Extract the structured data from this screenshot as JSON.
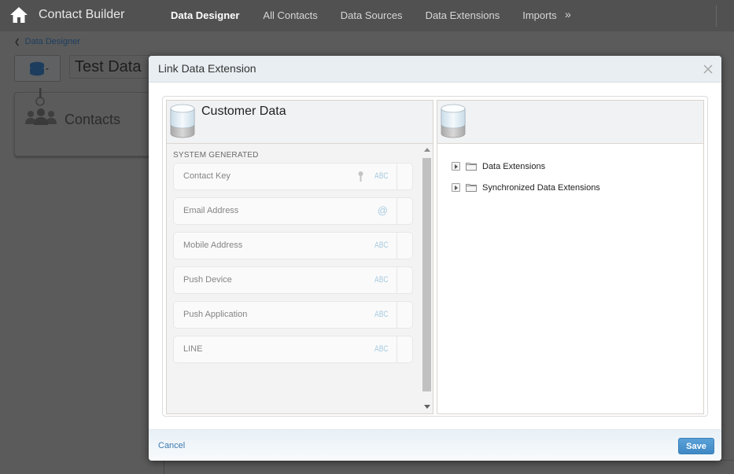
{
  "app": {
    "title": "Contact Builder",
    "home_icon": "home-icon"
  },
  "nav": {
    "items": [
      {
        "label": "Data Designer",
        "active": true
      },
      {
        "label": "All Contacts",
        "active": false
      },
      {
        "label": "Data Sources",
        "active": false
      },
      {
        "label": "Data Extensions",
        "active": false
      },
      {
        "label": "Imports",
        "active": false
      }
    ],
    "more_label": "»"
  },
  "page": {
    "breadcrumb": "Data Designer",
    "name_field_value": "Test Data",
    "db_menu_icon": "database-icon",
    "card_label": "Contacts"
  },
  "modal": {
    "title": "Link Data Extension",
    "close_icon": "close-icon",
    "left_panel": {
      "title": "Customer Data",
      "section_label": "SYSTEM GENERATED",
      "fields": [
        {
          "name": "Contact Key",
          "type": "ABC",
          "is_key": true
        },
        {
          "name": "Email Address",
          "type": "@",
          "is_key": false
        },
        {
          "name": "Mobile Address",
          "type": "ABC",
          "is_key": false
        },
        {
          "name": "Push Device",
          "type": "ABC",
          "is_key": false
        },
        {
          "name": "Push Application",
          "type": "ABC",
          "is_key": false
        },
        {
          "name": "LINE",
          "type": "ABC",
          "is_key": false
        }
      ]
    },
    "right_panel": {
      "title": "",
      "tree": [
        {
          "label": "Data Extensions",
          "expanded": false
        },
        {
          "label": "Synchronized Data Extensions",
          "expanded": false
        }
      ]
    },
    "footer": {
      "cancel_label": "Cancel",
      "save_label": "Save"
    }
  },
  "colors": {
    "accent_blue": "#3f88c5",
    "type_label": "#a9cbe0",
    "link_blue": "#3c7ab0"
  }
}
